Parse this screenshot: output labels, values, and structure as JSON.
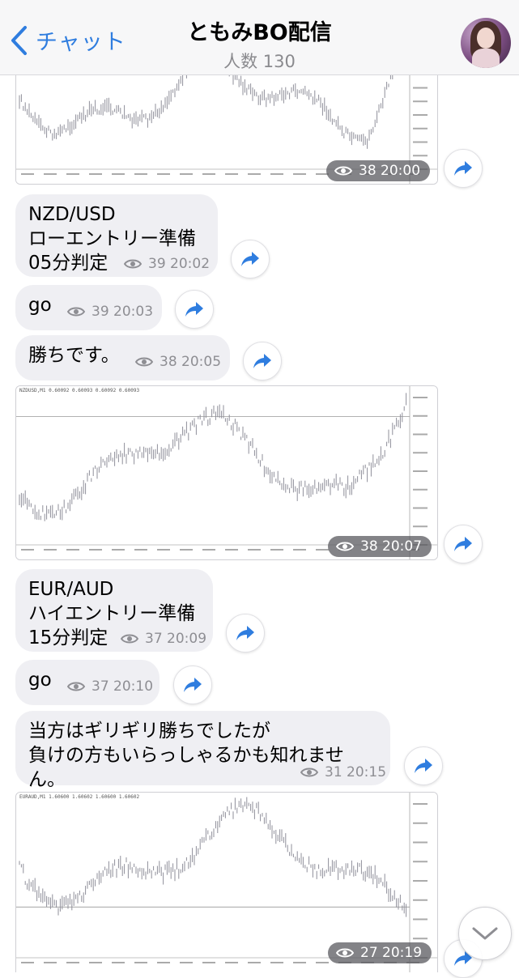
{
  "header": {
    "back_label": "チャット",
    "title": "ともみBO配信",
    "subtitle": "人数 130"
  },
  "icons": {
    "back": "chevron-left-icon",
    "views": "eye-icon",
    "share": "share-arrow-icon",
    "scroll": "chevron-down-icon"
  },
  "colors": {
    "accent": "#2f7ddf",
    "bubble": "#efeff3",
    "meta_text": "#8e8e93"
  },
  "messages": [
    {
      "type": "image",
      "views": "38",
      "time": "20:00",
      "chart_caption": ""
    },
    {
      "type": "text",
      "text": "NZD/USD\nローエントリー準備\n05分判定",
      "views": "39",
      "time": "20:02"
    },
    {
      "type": "text",
      "text": "go",
      "views": "39",
      "time": "20:03"
    },
    {
      "type": "text",
      "text": "勝ちです。",
      "views": "38",
      "time": "20:05"
    },
    {
      "type": "image",
      "views": "38",
      "time": "20:07",
      "chart_caption": "NZDUSD,M1 0.60092 0.60093 0.60092 0.60093"
    },
    {
      "type": "text",
      "text": "EUR/AUD\nハイエントリー準備\n15分判定",
      "views": "37",
      "time": "20:09"
    },
    {
      "type": "text",
      "text": "go",
      "views": "37",
      "time": "20:10"
    },
    {
      "type": "text",
      "text": "当方はギリギリ勝ちでしたが\n負けの方もいらっしゃるかも知れません。",
      "views": "31",
      "time": "20:15"
    },
    {
      "type": "image",
      "views": "27",
      "time": "20:19",
      "chart_caption": "EURAUD,M1 1.60600 1.60602 1.60600 1.60602"
    }
  ]
}
